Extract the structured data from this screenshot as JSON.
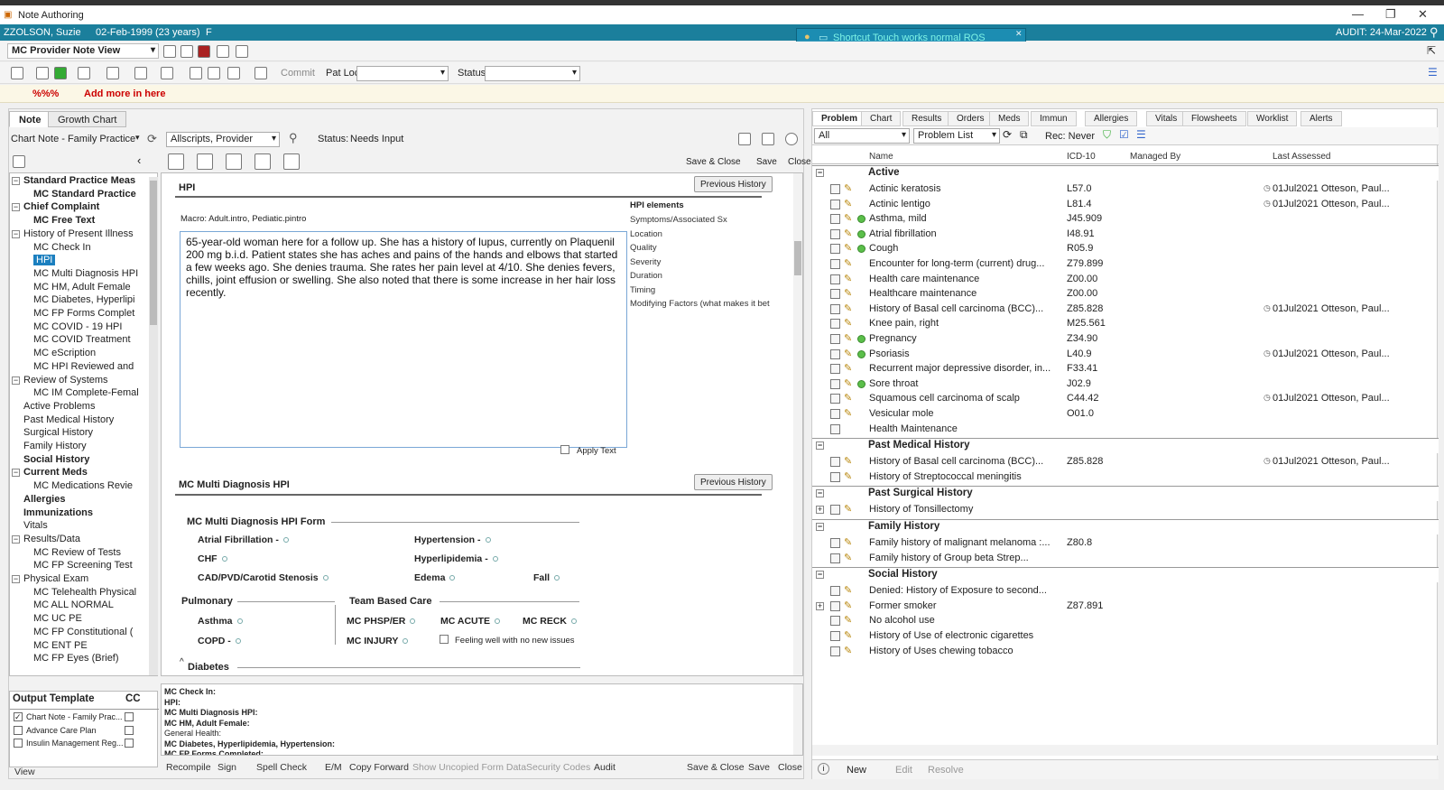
{
  "window": {
    "title": "Note Authoring"
  },
  "patient": {
    "name": "ZZOLSON, Suzie",
    "dob": "02-Feb-1999",
    "age": "(23 years)",
    "sex": "F",
    "audit": "AUDIT: 24-Mar-2022"
  },
  "overlay": {
    "text": "Shortcut Touch works normal ROS"
  },
  "toolbar": {
    "view": "MC Provider Note View",
    "commit": "Commit",
    "patloc": "Pat Loc",
    "status": "Status"
  },
  "macrobar": {
    "left": "%%%",
    "add": "Add more in here"
  },
  "note_tabs": [
    "Note",
    "Growth Chart"
  ],
  "note_header": {
    "template": "Chart Note - Family Practice",
    "provider": "Allscripts, Provider",
    "status_label": "Status:",
    "status_value": "Needs Input"
  },
  "editor_actions": {
    "save_close": "Save & Close",
    "save": "Save",
    "close": "Close"
  },
  "nav": [
    {
      "label": "Standard Practice Meas",
      "level": 0,
      "bold": true,
      "exp": "⊟"
    },
    {
      "label": "MC Standard Practice",
      "level": 1,
      "bold": true
    },
    {
      "label": "Chief Complaint",
      "level": 0,
      "bold": true,
      "exp": "⊟"
    },
    {
      "label": "MC Free Text",
      "level": 1,
      "bold": true
    },
    {
      "label": "History of Present Illness",
      "level": 0,
      "exp": "⊟"
    },
    {
      "label": "MC Check In",
      "level": 1
    },
    {
      "label": "HPI",
      "level": 1,
      "selected": true
    },
    {
      "label": "MC Multi Diagnosis HPI",
      "level": 1
    },
    {
      "label": "MC HM, Adult Female",
      "level": 1
    },
    {
      "label": "MC Diabetes, Hyperlipi",
      "level": 1
    },
    {
      "label": "MC FP Forms Complet",
      "level": 1
    },
    {
      "label": "MC COVID - 19 HPI",
      "level": 1
    },
    {
      "label": "MC COVID Treatment",
      "level": 1
    },
    {
      "label": "MC eScription",
      "level": 1
    },
    {
      "label": "MC HPI  Reviewed and",
      "level": 1
    },
    {
      "label": "Review of Systems",
      "level": 0,
      "exp": "⊟"
    },
    {
      "label": "MC IM Complete-Femal",
      "level": 1
    },
    {
      "label": "Active Problems",
      "level": 0
    },
    {
      "label": "Past Medical History",
      "level": 0
    },
    {
      "label": "Surgical History",
      "level": 0
    },
    {
      "label": "Family History",
      "level": 0
    },
    {
      "label": "Social History",
      "level": 0,
      "bold": true
    },
    {
      "label": "Current Meds",
      "level": 0,
      "bold": true,
      "exp": "⊟"
    },
    {
      "label": "MC Medications Revie",
      "level": 1
    },
    {
      "label": "Allergies",
      "level": 0,
      "bold": true
    },
    {
      "label": "Immunizations",
      "level": 0,
      "bold": true
    },
    {
      "label": "Vitals",
      "level": 0
    },
    {
      "label": "Results/Data",
      "level": 0,
      "exp": "⊟"
    },
    {
      "label": "MC Review of Tests",
      "level": 1
    },
    {
      "label": "MC FP Screening Test",
      "level": 1
    },
    {
      "label": "Physical Exam",
      "level": 0,
      "exp": "⊟"
    },
    {
      "label": "MC Telehealth Physical",
      "level": 1
    },
    {
      "label": "MC ALL NORMAL",
      "level": 1
    },
    {
      "label": "MC UC PE",
      "level": 1
    },
    {
      "label": "MC FP Constitutional (",
      "level": 1
    },
    {
      "label": "MC ENT PE",
      "level": 1
    },
    {
      "label": "MC FP Eyes (Brief)",
      "level": 1
    }
  ],
  "hpi": {
    "title": "HPI",
    "prev": "Previous History",
    "macro": "Macro: Adult.intro, Pediatic.pintro",
    "text": "65-year-old woman here for a follow up. She has a history of lupus, currently on Plaquenil 200 mg b.i.d. Patient states she has aches and pains of the hands and elbows that started a few weeks ago. She denies trauma. She rates her pain level at 4/10. She denies fevers, chills, joint effusion or swelling. She also noted that there is some increase in her hair loss recently.",
    "elements_title": "HPI elements",
    "elements": [
      "Symptoms/Associated Sx",
      "Location",
      "Quality",
      "Severity",
      "Duration",
      "Timing",
      "Modifying Factors (what makes it bet"
    ],
    "apply": "Apply Text"
  },
  "multi": {
    "title": "MC Multi Diagnosis HPI",
    "prev": "Previous History",
    "form_title": "MC Multi Diagnosis HPI Form",
    "items": {
      "afib": "Atrial Fibrillation -",
      "htn": "Hypertension -",
      "chf": "CHF",
      "hld": "Hyperlipidemia -",
      "cad": "CAD/PVD/Carotid Stenosis",
      "edema": "Edema",
      "fall": "Fall"
    },
    "pulm": "Pulmonary",
    "team": "Team Based Care",
    "asthma": "Asthma",
    "copd": "COPD -",
    "phsp": "MC PHSP/ER",
    "acute": "MC ACUTE",
    "reck": "MC RECK",
    "injury": "MC INJURY",
    "feeling": "Feeling well with no new issues",
    "diabetes": "Diabetes"
  },
  "output": {
    "title": "Output Template",
    "cc": "CC",
    "items": [
      {
        "label": "Chart Note - Family Prac...",
        "checked": true
      },
      {
        "label": "Advance Care Plan",
        "checked": false
      },
      {
        "label": "Insulin Management Reg...",
        "checked": false
      }
    ]
  },
  "preview": [
    "MC Check In:",
    "HPI:",
    "MC Multi Diagnosis HPI:",
    "MC HM, Adult Female:",
    "General Health:",
    "MC Diabetes, Hyperlipidemia, Hypertension:",
    "MC FP Forms Completed:"
  ],
  "bottom": {
    "view": "View",
    "recompile": "Recompile",
    "sign": "Sign",
    "spell": "Spell Check",
    "em": "E/M",
    "copy": "Copy Forward",
    "uncopied": "Show Uncopied Form Data",
    "security": "Security Codes",
    "audit": "Audit",
    "save_close": "Save & Close",
    "save": "Save",
    "close": "Close"
  },
  "right_tabs": [
    "Problem",
    "Chart",
    "Results",
    "Orders",
    "Meds",
    "Immun",
    "Allergies",
    "Vitals",
    "Flowsheets",
    "Worklist",
    "Alerts"
  ],
  "right_filter": {
    "all": "All",
    "list": "Problem List",
    "rec": "Rec: Never"
  },
  "columns": {
    "name": "Name",
    "icd": "ICD-10",
    "managed": "Managed By",
    "last": "Last Assessed"
  },
  "groups": [
    {
      "title": "Active",
      "rows": [
        {
          "name": "Actinic keratosis",
          "code": "L57.0",
          "last": "01Jul2021  Otteson,  Paul..."
        },
        {
          "name": "Actinic lentigo",
          "code": "L81.4",
          "last": "01Jul2021  Otteson,  Paul..."
        },
        {
          "name": "Asthma, mild",
          "code": "J45.909",
          "green": true
        },
        {
          "name": "Atrial fibrillation",
          "code": "I48.91",
          "green": true
        },
        {
          "name": "Cough",
          "code": "R05.9",
          "green": true
        },
        {
          "name": "Encounter for long-term (current) drug...",
          "code": "Z79.899"
        },
        {
          "name": "Health care maintenance",
          "code": "Z00.00"
        },
        {
          "name": "Healthcare maintenance",
          "code": "Z00.00"
        },
        {
          "name": "History of Basal cell carcinoma (BCC)...",
          "code": "Z85.828",
          "last": "01Jul2021  Otteson,  Paul..."
        },
        {
          "name": "Knee pain, right",
          "code": "M25.561"
        },
        {
          "name": "Pregnancy",
          "code": "Z34.90",
          "green": true
        },
        {
          "name": "Psoriasis",
          "code": "L40.9",
          "green": true,
          "last": "01Jul2021  Otteson,  Paul..."
        },
        {
          "name": "Recurrent major depressive disorder, in...",
          "code": "F33.41"
        },
        {
          "name": "Sore throat",
          "code": "J02.9",
          "green": true
        },
        {
          "name": "Squamous cell carcinoma of scalp",
          "code": "C44.42",
          "last": "01Jul2021  Otteson,  Paul..."
        },
        {
          "name": "Vesicular mole",
          "code": "O01.0"
        },
        {
          "name": "Health Maintenance",
          "code": "",
          "nopencil": true
        }
      ]
    },
    {
      "title": "Past Medical History",
      "rows": [
        {
          "name": "History of Basal cell carcinoma (BCC)...",
          "code": "Z85.828",
          "last": "01Jul2021  Otteson,  Paul..."
        },
        {
          "name": "History of Streptococcal meningitis",
          "code": ""
        }
      ]
    },
    {
      "title": "Past Surgical History",
      "rows": [
        {
          "name": "History of Tonsillectomy",
          "code": "",
          "plus": true
        }
      ]
    },
    {
      "title": "Family History",
      "rows": [
        {
          "name": "Family history of malignant melanoma :...",
          "code": "Z80.8"
        },
        {
          "name": "Family history of Group beta Strep...",
          "code": ""
        }
      ]
    },
    {
      "title": "Social History",
      "rows": [
        {
          "name": "Denied: History of Exposure to second...",
          "code": ""
        },
        {
          "name": "Former smoker",
          "code": "Z87.891",
          "plus": true
        },
        {
          "name": "No alcohol use",
          "code": ""
        },
        {
          "name": "History of Use of electronic cigarettes",
          "code": ""
        },
        {
          "name": "History of Uses chewing tobacco",
          "code": ""
        }
      ]
    }
  ],
  "right_bottom": {
    "new": "New",
    "edit": "Edit",
    "resolve": "Resolve"
  }
}
